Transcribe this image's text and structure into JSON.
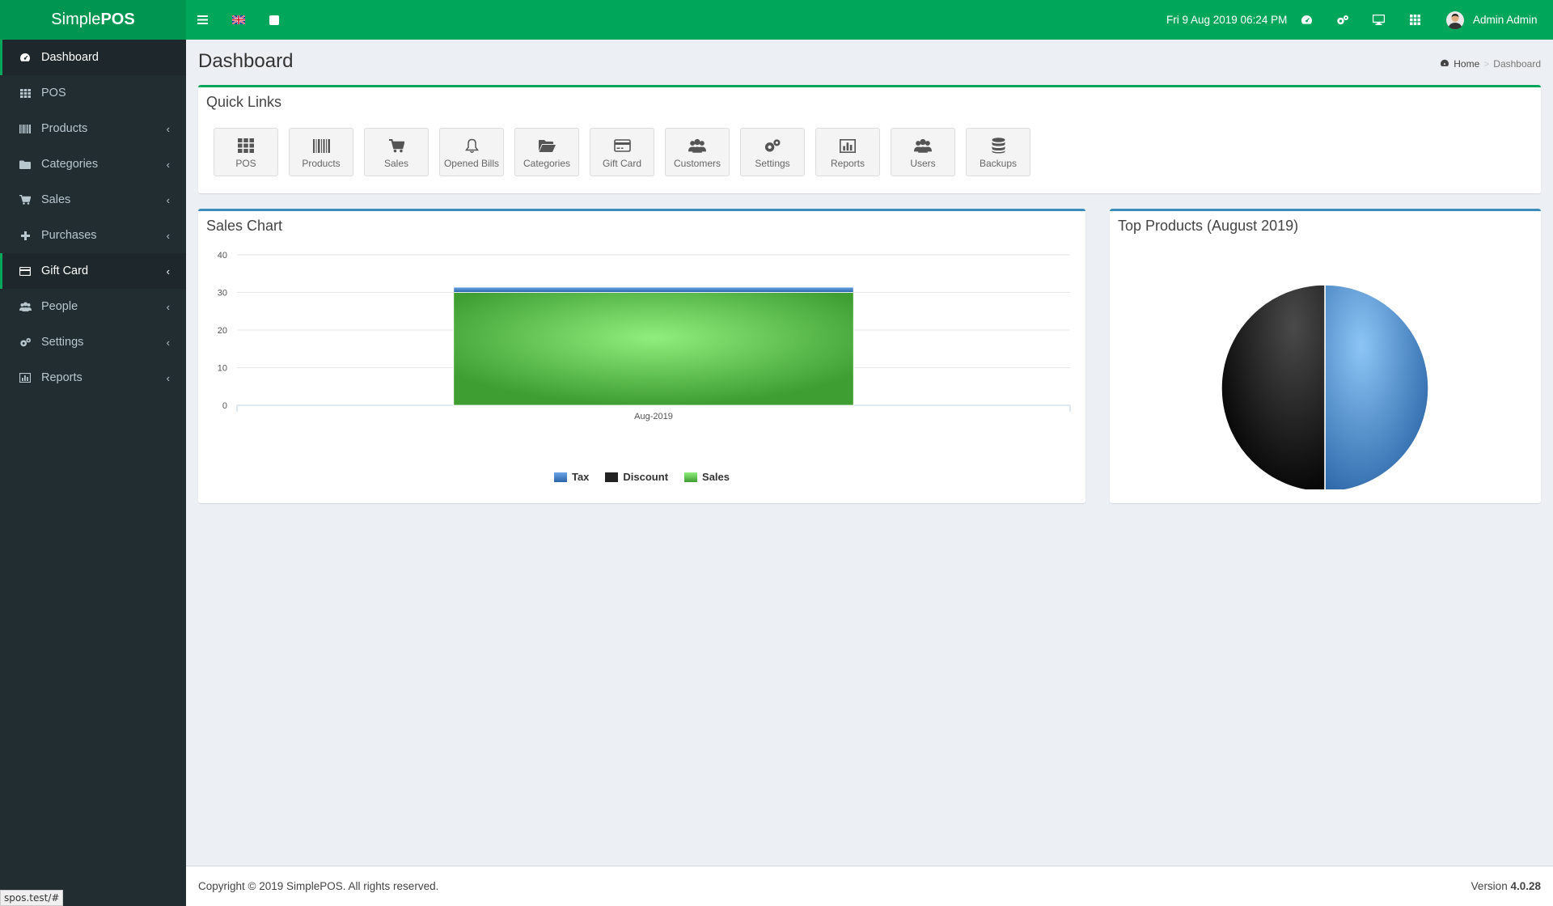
{
  "app": {
    "logo_light": "Simple",
    "logo_bold": "POS"
  },
  "topbar": {
    "datetime": "Fri 9 Aug 2019 06:24 PM",
    "user_name": "Admin Admin",
    "icons": [
      "menu-icon",
      "uk-flag-icon",
      "square-icon",
      "dashboard-icon",
      "cogs-icon",
      "desktop-icon",
      "grid-icon",
      "user-avatar"
    ]
  },
  "sidebar": {
    "items": [
      {
        "label": "Dashboard",
        "icon": "dashboard-icon"
      },
      {
        "label": "POS",
        "icon": "grid-icon"
      },
      {
        "label": "Products",
        "icon": "barcode-icon"
      },
      {
        "label": "Categories",
        "icon": "folder-icon"
      },
      {
        "label": "Sales",
        "icon": "cart-icon"
      },
      {
        "label": "Purchases",
        "icon": "plus-icon"
      },
      {
        "label": "Gift Card",
        "icon": "credit-card-icon"
      },
      {
        "label": "People",
        "icon": "users-icon"
      },
      {
        "label": "Settings",
        "icon": "cogs-icon"
      },
      {
        "label": "Reports",
        "icon": "bar-chart-icon"
      }
    ]
  },
  "page": {
    "title": "Dashboard",
    "breadcrumb": {
      "home": "Home",
      "current": "Dashboard"
    }
  },
  "quick_links": {
    "title": "Quick Links",
    "items": [
      {
        "label": "POS",
        "icon": "grid-icon"
      },
      {
        "label": "Products",
        "icon": "barcode-icon"
      },
      {
        "label": "Sales",
        "icon": "cart-icon"
      },
      {
        "label": "Opened Bills",
        "icon": "bell-icon"
      },
      {
        "label": "Categories",
        "icon": "folder-open-icon"
      },
      {
        "label": "Gift Card",
        "icon": "credit-card-icon"
      },
      {
        "label": "Customers",
        "icon": "users-icon"
      },
      {
        "label": "Settings",
        "icon": "cogs-icon"
      },
      {
        "label": "Reports",
        "icon": "bar-chart-icon"
      },
      {
        "label": "Users",
        "icon": "users-icon"
      },
      {
        "label": "Backups",
        "icon": "database-icon"
      }
    ]
  },
  "sales_chart": {
    "title": "Sales Chart",
    "accent": "#3c8dbc"
  },
  "top_products": {
    "title": "Top Products (August 2019)"
  },
  "chart_data": [
    {
      "type": "bar",
      "title": "Sales Chart",
      "categories": [
        "Aug-2019"
      ],
      "stacked": true,
      "series": [
        {
          "name": "Sales",
          "values": [
            30
          ],
          "color": "#5cb85c"
        },
        {
          "name": "Discount",
          "values": [
            0
          ],
          "color": "#222222"
        },
        {
          "name": "Tax",
          "values": [
            1.4
          ],
          "color": "#3c7fc8"
        }
      ],
      "legend_order": [
        "Tax",
        "Discount",
        "Sales"
      ],
      "yticks": [
        "40",
        "30",
        "20",
        "10",
        "0"
      ],
      "ylim": [
        0,
        40
      ],
      "grid": true,
      "legend": "bottom"
    },
    {
      "type": "pie",
      "title": "Top Products (August 2019)",
      "slices": [
        {
          "value": 50,
          "color": "#4a8fd4"
        },
        {
          "value": 50,
          "color": "#1a1a1a"
        }
      ]
    }
  ],
  "footer": {
    "copyright": "Copyright © 2019 SimplePOS. All rights reserved.",
    "version_label": "Version ",
    "version": "4.0.28"
  },
  "status_url": "spos.test/#",
  "colors": {
    "brand": "#00a65a",
    "sidebar": "#222d32",
    "box_primary": "#3c8dbc"
  }
}
